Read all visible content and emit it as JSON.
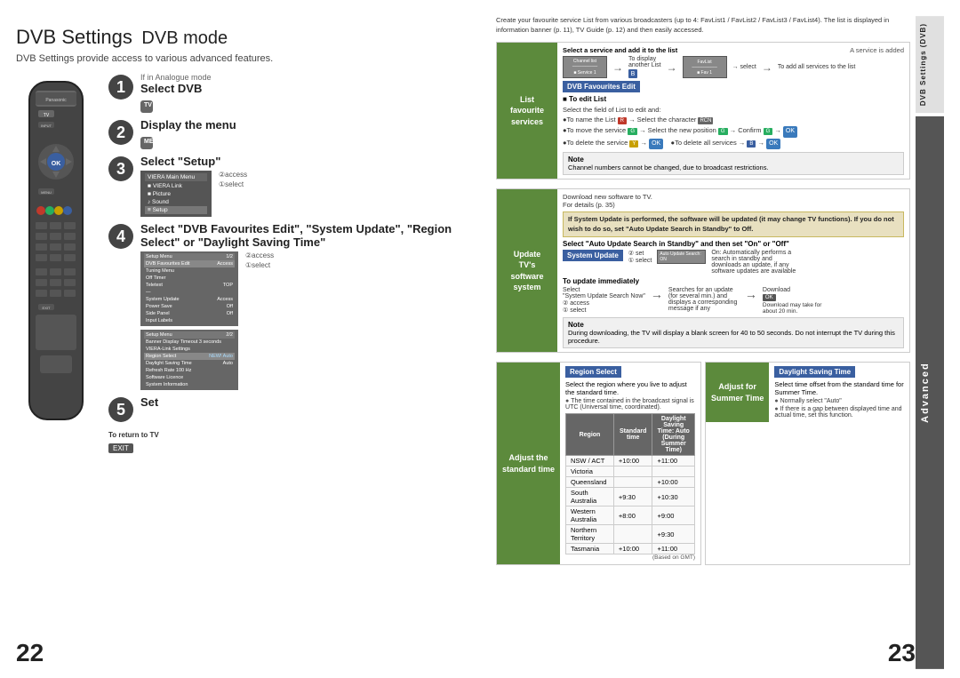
{
  "page": {
    "title": "DVB Settings",
    "title_mode": "DVB mode",
    "subtitle": "DVB Settings provide access to various advanced features.",
    "page_num_left": "22",
    "page_num_right": "23"
  },
  "steps": [
    {
      "num": "1",
      "label": "Select DVB",
      "sublabel": "If in Analogue mode",
      "btn": "TV"
    },
    {
      "num": "2",
      "label": "Display the menu",
      "sublabel": "",
      "btn": "MENU"
    },
    {
      "num": "3",
      "label": "Select \"Setup\"",
      "sublabel": "",
      "menu_items": [
        "VIERA Main Menu",
        "VIERA Link",
        "Picture",
        "Sound",
        "Setup"
      ]
    },
    {
      "num": "4",
      "label": "Select \"DVB Favourites Edit\", \"System Update\", \"Region Select\" or \"Daylight Saving Time\"",
      "sublabel": ""
    },
    {
      "num": "5",
      "label": "Set",
      "sublabel": ""
    }
  ],
  "to_return": {
    "label": "To return to TV",
    "btn": "EXIT"
  },
  "right": {
    "intro": "Create your favourite service List from various broadcasters (up to 4: FavList1 / FavList2 / FavList3 / FavList4).\nThe list is displayed in information banner (p. 11), TV Guide (p. 12) and then easily accessed.",
    "sections": {
      "list_favourite": {
        "label": "List\nfavourite\nservices",
        "dvb_badge": "DVB\nFavourites\nEdit",
        "select_label": "Select a service and add it to the list",
        "service_added": "A service is added",
        "to_display": "To display another List",
        "to_add_all": "To add all services to the list",
        "to_edit_title": "To edit List",
        "edit_instructions": [
          "Select the field of List to edit and:",
          "To name the List → Select the character",
          "To move the service → Select the new position → Confirm →",
          "To delete the service → To delete all services →"
        ],
        "note_title": "Note",
        "note_text": "Channel numbers cannot be changed, due to broadcast restrictions."
      },
      "update": {
        "label": "Update\nTV's\nsoftware\nsystem",
        "badge": "System\nUpdate",
        "download_note": "Download new software to TV.\nFor details (p. 35)",
        "warning": "If System Update is performed, the software will be updated (it may change TV functions). If you do not wish to do so, set \"Auto Update Search in Standby\" to Off.",
        "auto_update_title": "Select \"Auto Update Search in Standby\" and then set \"On\" or \"Off\"",
        "on_description": "On: Automatically performs a search in standby and downloads an update, if any software updates are available",
        "to_update_title": "To update immediately",
        "to_update_steps": [
          "Select \"System Update Search Now\"",
          "② access",
          "① select"
        ],
        "searches": "Searches for an update (for several min.) and displays a corresponding message if any",
        "download": "Download",
        "download_note2": "Download may take for about 20 min.",
        "note2_title": "Note",
        "note2_text": "During downloading, the TV will display a blank screen for 40 to 50 seconds. Do not interrupt the TV during this procedure."
      },
      "region": {
        "label": "Adjust the\nstandard time",
        "badge": "Region\nSelect",
        "description": "Select the region where you live to adjust the standard time.",
        "bullet1": "The time contained in the broadcast signal is UTC (Universal time, coordinated).",
        "table_headers": [
          "Region",
          "Standard time",
          "Daylight Saving Time: Auto\n(During Summer Time)"
        ],
        "table_rows": [
          [
            "NSW / ACT",
            "+10:00",
            "+11:00"
          ],
          [
            "Victoria",
            "",
            ""
          ],
          [
            "Queensland",
            "",
            "+10:00"
          ],
          [
            "South Australia",
            "+9:30",
            "+10:30"
          ],
          [
            "Western Australia",
            "+8:00",
            "+9:00"
          ],
          [
            "Northern Territory",
            "",
            "+9:30"
          ],
          [
            "Tasmania",
            "+10:00",
            "+11:00"
          ]
        ],
        "table_note": "(Based on GMT)"
      },
      "daylight": {
        "label": "Adjust for\nSummer Time",
        "badge": "Daylight\nSaving Time",
        "description": "Select time offset from the standard time for Summer Time.",
        "bullet1": "Normally select \"Auto\"",
        "bullet2": "If there is a gap between displayed time and actual time, set this function."
      }
    }
  },
  "sidebar": {
    "dvb_label": "DVB Settings (DVB)",
    "advanced_label": "Advanced"
  }
}
